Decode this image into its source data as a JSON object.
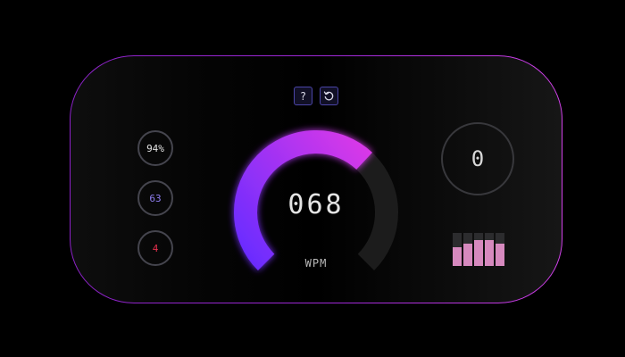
{
  "controls": {
    "help_label": "?",
    "reset_icon": "reset-icon"
  },
  "stats": {
    "accuracy": "94%",
    "cpm": "63",
    "errors": "4"
  },
  "gauge": {
    "value": "068",
    "unit": "WPM",
    "fill_fraction": 0.66,
    "gradient_start": "#6a2cff",
    "gradient_end": "#e23ae6",
    "track_color": "#1c1c1c"
  },
  "timer": {
    "value": "0"
  },
  "level_bars": {
    "levels": [
      0.56,
      0.68,
      0.78,
      0.78,
      0.68
    ],
    "fill_color": "#d689be",
    "empty_color": "#2c2c2e"
  },
  "colors": {
    "border_start": "#8c22c8",
    "border_end": "#d040e8",
    "accuracy_text": "#e6e6e6",
    "cpm_text": "#8f7ef0",
    "errors_text": "#e8304e"
  }
}
